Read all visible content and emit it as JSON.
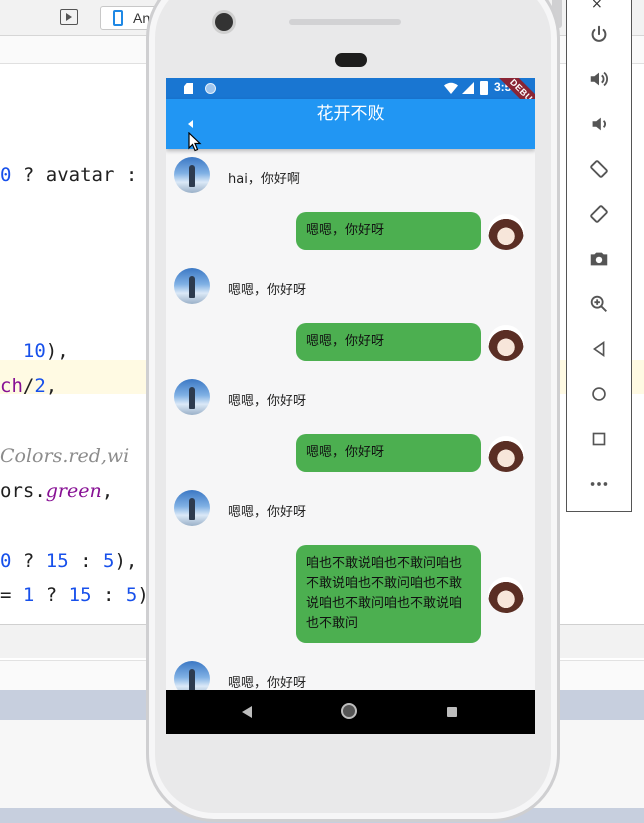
{
  "ide": {
    "device_label": "An",
    "code_lines": [
      {
        "pre": "0 ? avatar :",
        "num": "",
        "mid": "",
        "post": ""
      },
      {
        "num1": "10",
        "post1": "),"
      },
      {
        "purple": "ch",
        "mid": "/",
        "num": "2",
        "post": ","
      },
      {
        "text": "Colors.red,wi"
      },
      {
        "pre": "ors.",
        "ital": "green",
        "post": ","
      },
      {
        "num_a": "0",
        "q": " ? ",
        "num_b": "15",
        "c": " : ",
        "num_c": "5",
        "post": "),"
      },
      {
        "eq": "= ",
        "num_a": "1",
        "q": " ? ",
        "num_b": "15",
        "c": " : ",
        "num_c": "5",
        "post": ")"
      }
    ]
  },
  "emulator_panel": {
    "close_label": "×",
    "buttons": [
      "power-icon",
      "volume-up-icon",
      "volume-down-icon",
      "rotate-left-icon",
      "rotate-right-icon",
      "camera-icon",
      "zoom-icon",
      "back-icon",
      "home-icon",
      "overview-icon",
      "more-icon"
    ]
  },
  "status_bar": {
    "time": "3:58",
    "debug_banner": "DEBUG"
  },
  "app_bar": {
    "title": "花开不败"
  },
  "messages": [
    {
      "side": "left",
      "text": "hai，你好啊"
    },
    {
      "side": "right",
      "text": "嗯嗯，你好呀"
    },
    {
      "side": "left",
      "text": "嗯嗯，你好呀"
    },
    {
      "side": "right",
      "text": "嗯嗯，你好呀"
    },
    {
      "side": "left",
      "text": "嗯嗯，你好呀"
    },
    {
      "side": "right",
      "text": "嗯嗯，你好呀"
    },
    {
      "side": "left",
      "text": "嗯嗯，你好呀"
    },
    {
      "side": "right",
      "text": "咱也不敢说咱也不敢问咱也不敢说咱也不敢问咱也不敢说咱也不敢问咱也不敢说咱也不敢问"
    },
    {
      "side": "left",
      "text": "嗯嗯，你好呀"
    }
  ],
  "colors": {
    "app_bar": "#2196f3",
    "status_bar": "#1976d2",
    "bubble": "#4caf50",
    "nav_bar": "#000000"
  }
}
